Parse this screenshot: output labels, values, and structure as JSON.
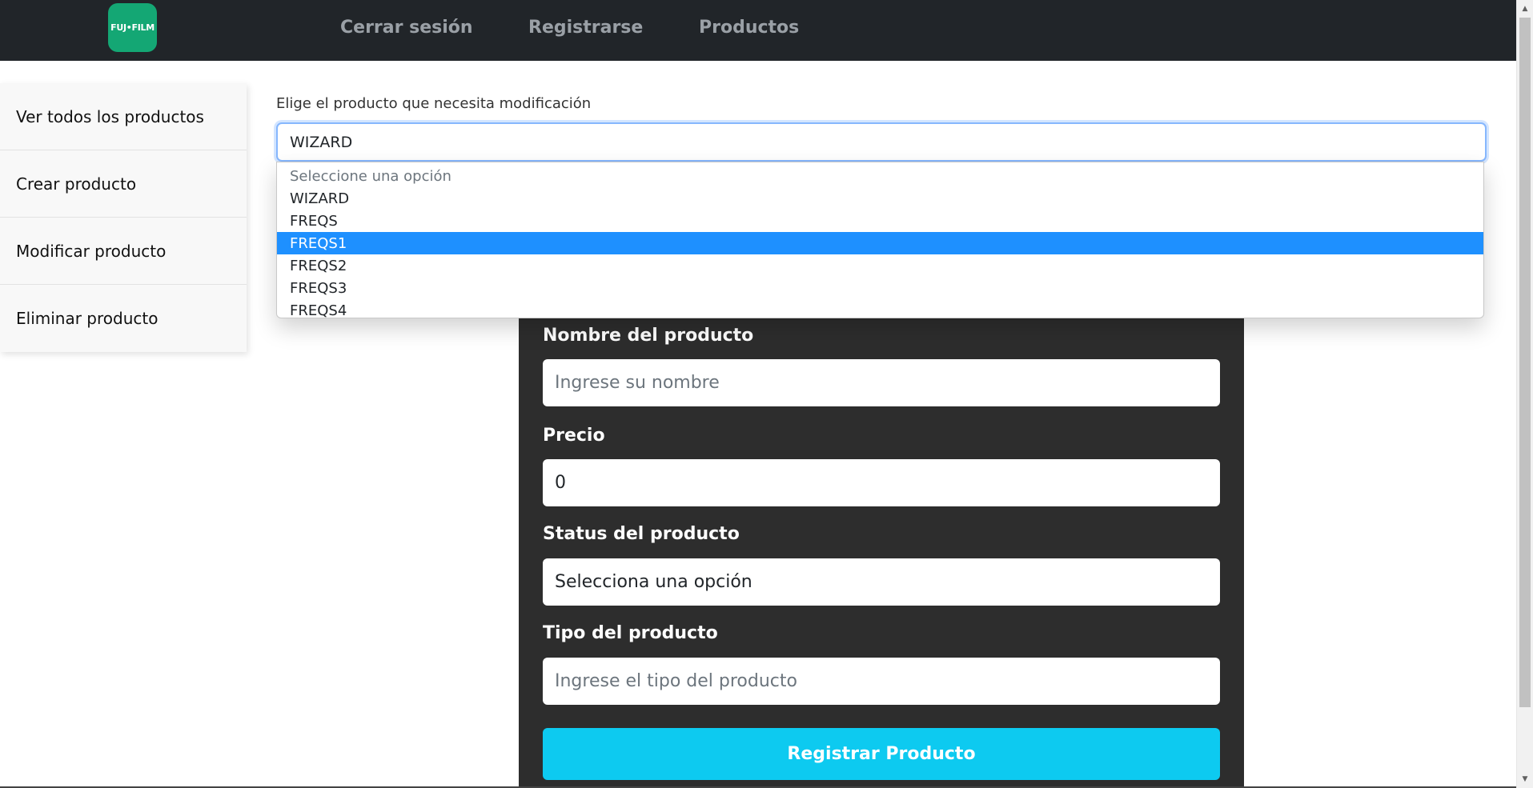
{
  "header": {
    "logo_text": "FUJ•FILM",
    "nav": [
      "Cerrar sesión",
      "Registrarse",
      "Productos"
    ]
  },
  "sidebar": {
    "items": [
      {
        "label": "Ver todos los productos"
      },
      {
        "label": "Crear producto"
      },
      {
        "label": "Modificar producto"
      },
      {
        "label": "Eliminar producto"
      }
    ]
  },
  "product_select": {
    "label": "Elige el producto que necesita modificación",
    "value": "WIZARD",
    "options": [
      "Seleccione una opción",
      "WIZARD",
      "FREQS",
      "FREQS1",
      "FREQS2",
      "FREQS3",
      "FREQS4"
    ],
    "highlighted": "FREQS1"
  },
  "form": {
    "name_label": "Nombre del producto",
    "name_placeholder": "Ingrese su nombre",
    "price_label": "Precio",
    "price_value": "0",
    "status_label": "Status del producto",
    "status_value": "Selecciona una opción",
    "type_label": "Tipo del producto",
    "type_placeholder": "Ingrese el tipo del producto",
    "submit_label": "Registrar Producto"
  },
  "colors": {
    "navbar": "#212529",
    "logo": "#14a774",
    "card": "#2d2d2d",
    "button": "#0dcaf0",
    "highlight": "#1e90ff"
  }
}
